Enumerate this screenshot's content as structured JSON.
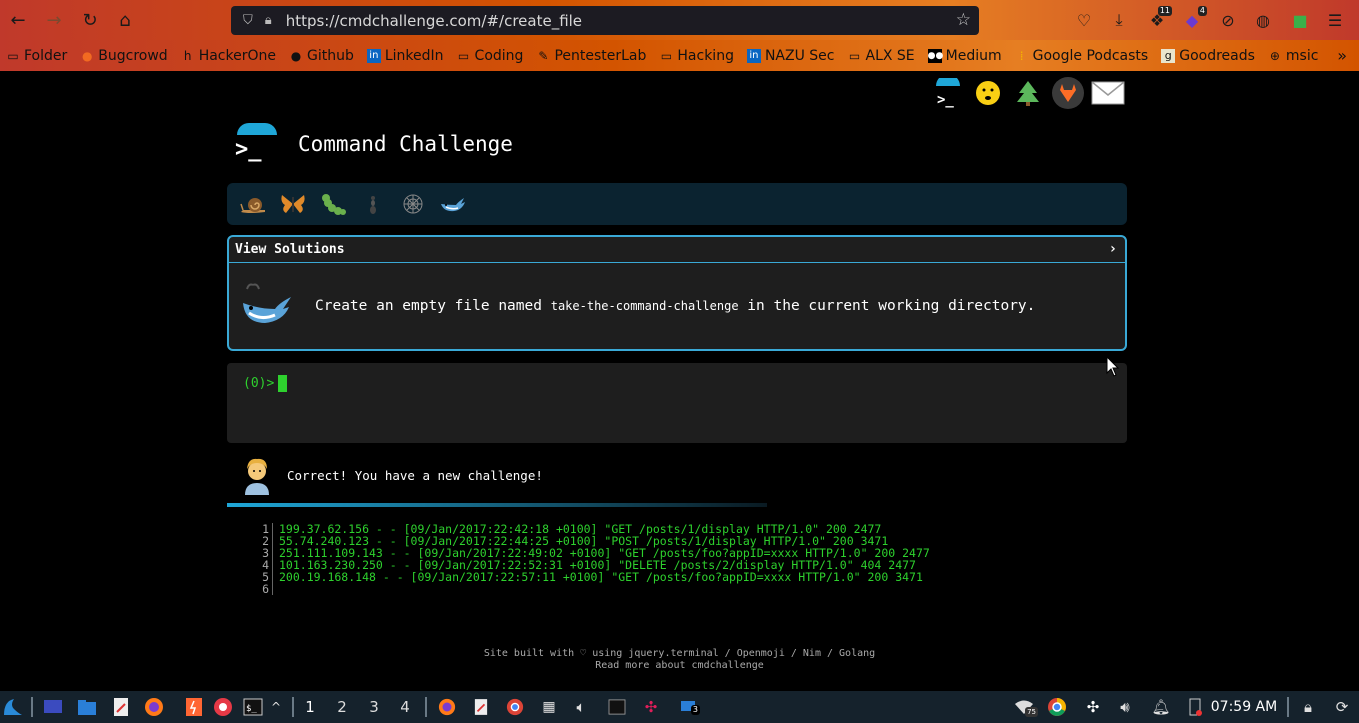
{
  "browser": {
    "url": "https://cmdchallenge.com/#/create_file",
    "toolbar_badges": {
      "extension_a": "11",
      "extension_b": "4"
    },
    "bookmarks": [
      {
        "label": "Folder",
        "icon": "folder-icon"
      },
      {
        "label": "Bugcrowd",
        "icon": "bugcrowd-icon"
      },
      {
        "label": "HackerOne",
        "icon": "hackerone-icon"
      },
      {
        "label": "Github",
        "icon": "github-icon"
      },
      {
        "label": "LinkedIn",
        "icon": "linkedin-icon"
      },
      {
        "label": "Coding",
        "icon": "folder-icon"
      },
      {
        "label": "PentesterLab",
        "icon": "pentesterlab-icon"
      },
      {
        "label": "Hacking",
        "icon": "folder-icon"
      },
      {
        "label": "NAZU Sec",
        "icon": "linkedin-icon"
      },
      {
        "label": "ALX SE",
        "icon": "folder-icon"
      },
      {
        "label": "Medium",
        "icon": "medium-icon"
      },
      {
        "label": "Google Podcasts",
        "icon": "podcasts-icon"
      },
      {
        "label": "Goodreads",
        "icon": "goodreads-icon"
      },
      {
        "label": "msic",
        "icon": "globe-icon"
      }
    ]
  },
  "page": {
    "title": "Command Challenge",
    "logo_prompt": ">_",
    "view_solutions": "View Solutions",
    "chevron": "›",
    "challenge_prefix": "Create an empty file named",
    "challenge_code": "take-the-command-challenge",
    "challenge_suffix": "in the current working directory.",
    "prompt": "(0)>",
    "feedback": "Correct! You have a new challenge!",
    "progress_fraction": 0.6,
    "log_lines": [
      {
        "n": "1",
        "text": "199.37.62.156 - - [09/Jan/2017:22:42:18 +0100] \"GET /posts/1/display HTTP/1.0\" 200 2477"
      },
      {
        "n": "2",
        "text": "55.74.240.123 - - [09/Jan/2017:22:44:25 +0100] \"POST /posts/1/display HTTP/1.0\" 200 3471"
      },
      {
        "n": "3",
        "text": "251.111.109.143 - - [09/Jan/2017:22:49:02 +0100] \"GET /posts/foo?appID=xxxx HTTP/1.0\" 200 2477"
      },
      {
        "n": "4",
        "text": "101.163.230.250 - - [09/Jan/2017:22:52:31 +0100] \"DELETE /posts/2/display HTTP/1.0\" 404 2477"
      },
      {
        "n": "5",
        "text": "200.19.168.148 - - [09/Jan/2017:22:57:11 +0100] \"GET /posts/foo?appID=xxxx HTTP/1.0\" 200 3471"
      },
      {
        "n": "6",
        "text": ""
      }
    ],
    "footer_line1": "Site built with ♡ using jquery.terminal / Openmoji / Nim / Golang",
    "footer_line2": "Read more about cmdchallenge"
  },
  "taskbar": {
    "workspaces": [
      "1",
      "2",
      "3",
      "4"
    ],
    "active_workspace": "1",
    "wifi_badge": "75",
    "notification_badge": "3",
    "clock": "07:59 AM"
  },
  "colors": {
    "accent": "#1fa7d8",
    "terminal_green": "#2ed12e",
    "panel_border": "#3aa9d6"
  }
}
